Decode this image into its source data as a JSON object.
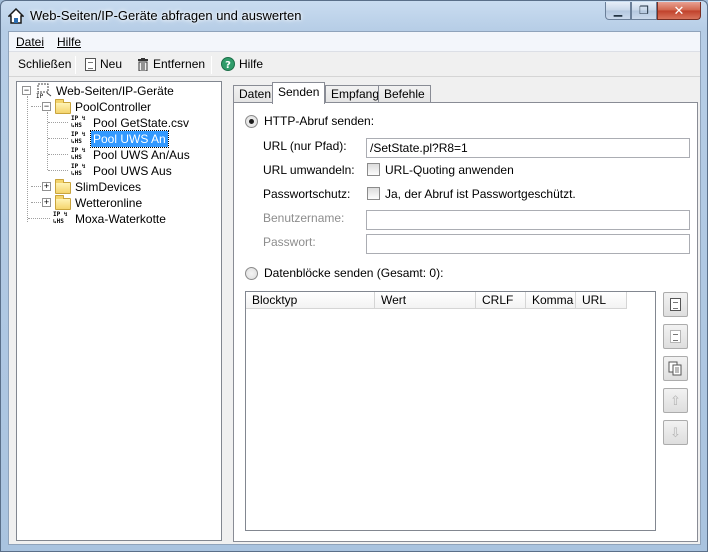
{
  "window": {
    "title": "Web-Seiten/IP-Geräte abfragen und auswerten",
    "minimize": "▁",
    "maximize": "❐",
    "close": "✕"
  },
  "menu": {
    "file": "Datei",
    "help": "Hilfe"
  },
  "toolbar": {
    "close_label": "Schließen",
    "new_label": "Neu",
    "remove_label": "Entfernen",
    "help_label": "Hilfe"
  },
  "tree": {
    "root": "Web-Seiten/IP-Geräte",
    "pool_controller": "PoolController",
    "children": [
      "Pool GetState.csv",
      "Pool UWS An",
      "Pool UWS An/Aus",
      "Pool UWS Aus"
    ],
    "slim_devices": "SlimDevices",
    "wetteronline": "Wetteronline",
    "moxa": "Moxa-Waterkotte"
  },
  "tabs": [
    "Daten",
    "Senden",
    "Empfang",
    "Befehle"
  ],
  "send": {
    "http_radio": "HTTP-Abruf senden:",
    "url_label": "URL (nur Pfad):",
    "url_value": "/SetState.pl?R8=1",
    "convert_label": "URL umwandeln:",
    "convert_check": "URL-Quoting anwenden",
    "password_label": "Passwortschutz:",
    "password_check": "Ja, der Abruf ist Passwortgeschützt.",
    "username_label": "Benutzername:",
    "password_field_label": "Passwort:",
    "blocks_radio": "Datenblöcke senden (Gesamt: 0):"
  },
  "list": {
    "columns": [
      "Blocktyp",
      "Wert",
      "CRLF",
      "Komma",
      "URL"
    ]
  }
}
